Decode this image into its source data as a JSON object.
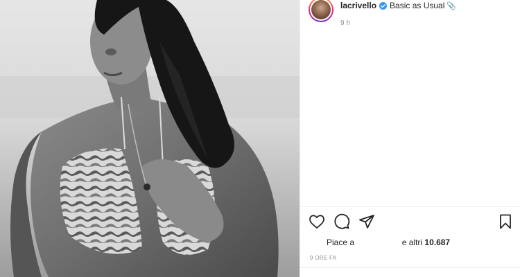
{
  "post": {
    "username": "lacrivello",
    "caption": "Basic as Usual",
    "caption_emoji": "📎",
    "time_ago": "9 h",
    "likes_prefix": "Piace a",
    "likes_suffix": "e altri",
    "likes_count": "10.687",
    "timestamp": "9 ORE FA",
    "verified_color": "#3897f0",
    "photo_alt": "Black and white photo"
  },
  "icons": {
    "like": "heart-icon",
    "comment": "comment-icon",
    "share": "paper-plane-icon",
    "save": "bookmark-icon",
    "verified": "verified-badge-icon"
  }
}
